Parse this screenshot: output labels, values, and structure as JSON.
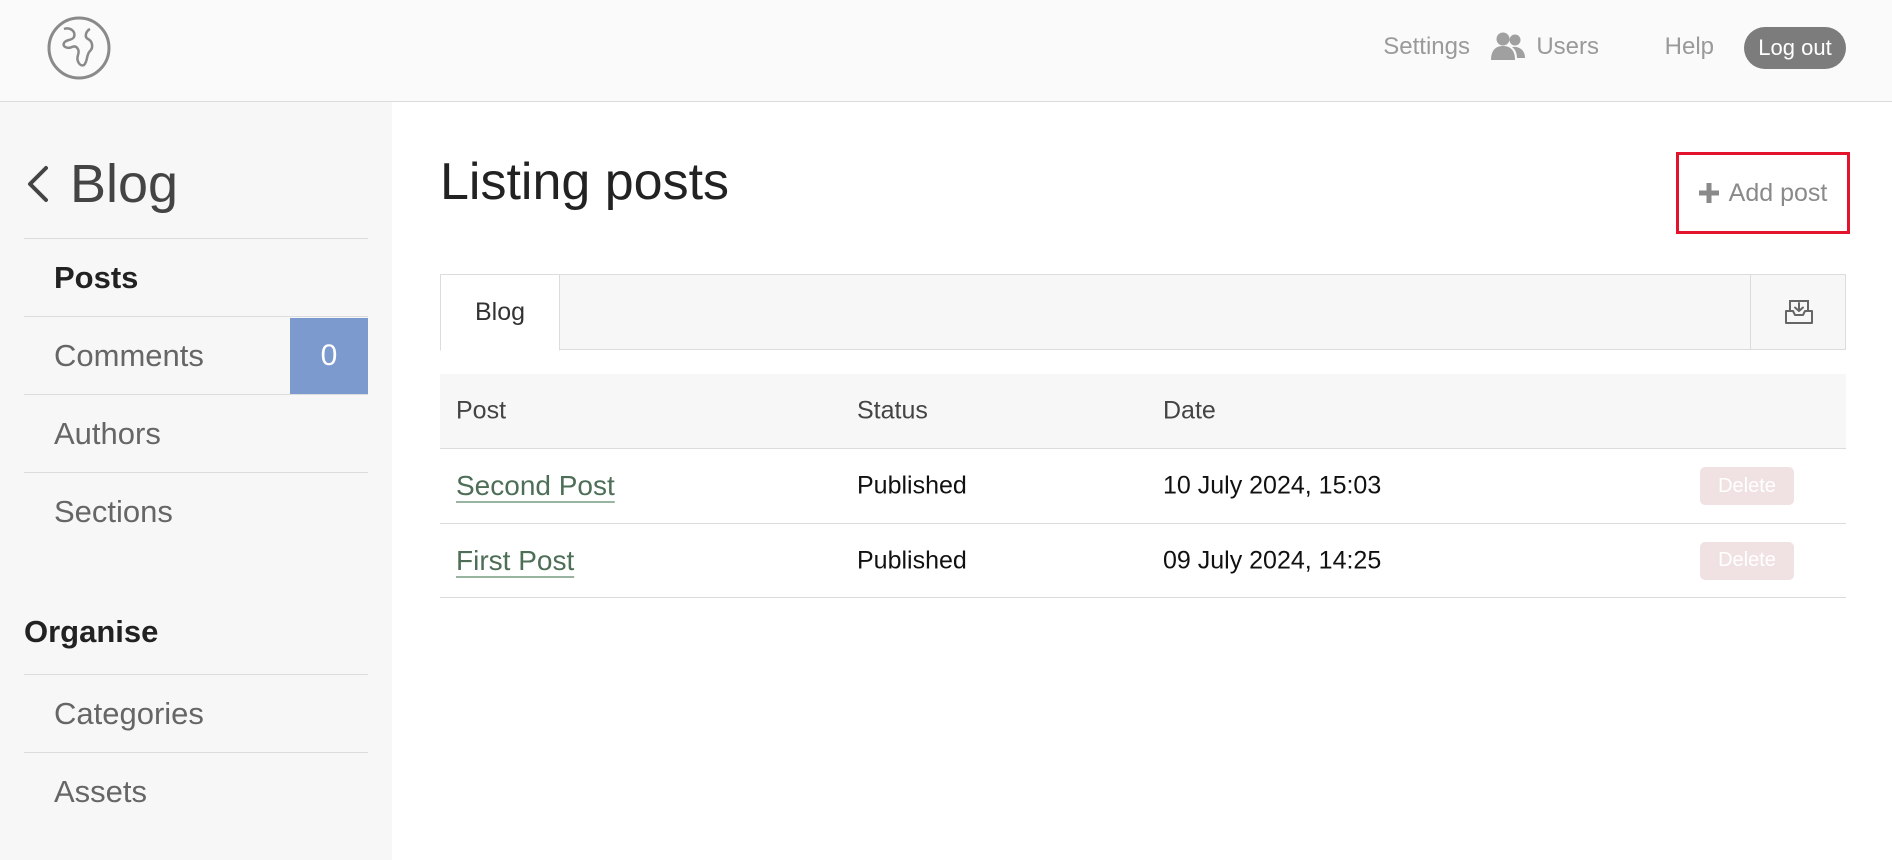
{
  "header": {
    "nav": {
      "settings": "Settings",
      "users": "Users",
      "help": "Help",
      "logout": "Log out"
    }
  },
  "sidebar": {
    "back_label": "Blog",
    "items": [
      {
        "label": "Posts"
      },
      {
        "label": "Comments",
        "badge": "0"
      },
      {
        "label": "Authors"
      },
      {
        "label": "Sections"
      }
    ],
    "organise_heading": "Organise",
    "organise_items": [
      {
        "label": "Categories"
      },
      {
        "label": "Assets"
      }
    ]
  },
  "main": {
    "title": "Listing posts",
    "add_post_label": "Add post",
    "tab_label": "Blog",
    "table": {
      "headers": [
        "Post",
        "Status",
        "Date"
      ],
      "rows": [
        {
          "post": "Second Post",
          "status": "Published",
          "date": "10 July 2024, 15:03",
          "action": "Delete"
        },
        {
          "post": "First Post",
          "status": "Published",
          "date": "09 July 2024, 14:25",
          "action": "Delete"
        }
      ]
    }
  },
  "colors": {
    "badge": "#7c9acd",
    "highlight": "#e3132b",
    "link": "#4e6e58",
    "logout_bg": "#7c7c7c"
  },
  "icons": [
    "globe-logo-icon",
    "users-icon",
    "chevron-left-icon",
    "plus-icon",
    "inbox-download-icon"
  ]
}
